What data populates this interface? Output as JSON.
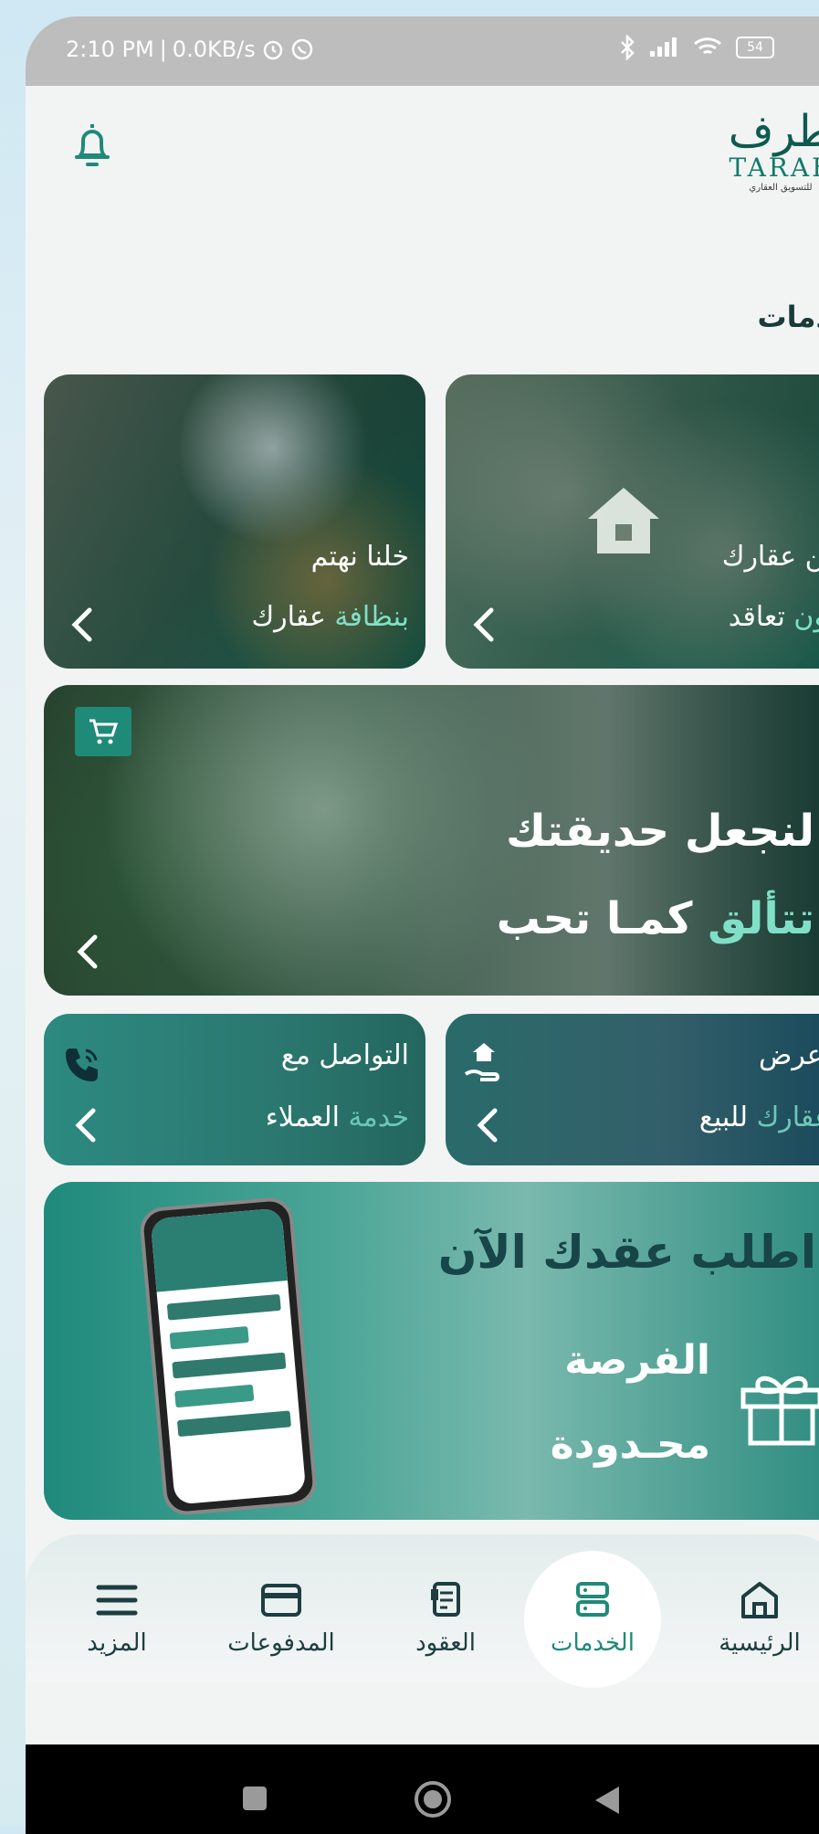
{
  "status_bar": {
    "time": "2:10 PM",
    "net_speed": "0.0KB/s",
    "battery": "54",
    "icons": [
      "alarm-icon",
      "whatsapp-icon",
      "bluetooth-icon",
      "signal-icon",
      "wifi-icon",
      "battery-icon"
    ]
  },
  "header": {
    "logo_ar": "طرف",
    "logo_en": "TARAF",
    "logo_sub": "للتسويق العقاري",
    "bell_icon": "bell-icon"
  },
  "section_title": "الخدمات",
  "cards": {
    "maintenance": {
      "line1": "صُن عقارك",
      "line2_hl": "بدون",
      "line2_rest": " تعاقد"
    },
    "cleaning": {
      "line1": "خلنا نهتم",
      "line2_hl": "بنظافة",
      "line2_rest": " عقارك"
    },
    "garden": {
      "line1": "لنجعل حديقتك",
      "line2_hl": "تتألق",
      "line2_rest": " كمـا تحب"
    }
  },
  "actions": {
    "sell": {
      "line1": "اعرض",
      "line2_hl": "عقارك",
      "line2_rest": " للبيع"
    },
    "support": {
      "line1": "التواصل مع",
      "line2_hl": "خدمة",
      "line2_rest": " العملاء"
    }
  },
  "promo": {
    "title": "اطلب عقدك الآن",
    "line2": "الفرصة",
    "line3": "محـدودة"
  },
  "bottom_nav": [
    {
      "key": "home",
      "label": "الرئيسية",
      "icon": "home-icon",
      "active": false
    },
    {
      "key": "services",
      "label": "الخدمات",
      "icon": "services-icon",
      "active": true
    },
    {
      "key": "contracts",
      "label": "العقود",
      "icon": "contracts-icon",
      "active": false
    },
    {
      "key": "payments",
      "label": "المدفوعات",
      "icon": "card-icon",
      "active": false
    },
    {
      "key": "more",
      "label": "المزيد",
      "icon": "menu-icon",
      "active": false
    }
  ],
  "colors": {
    "brand": "#1f8a78",
    "highlight": "#7fe0c7",
    "dark_text": "#174548"
  }
}
